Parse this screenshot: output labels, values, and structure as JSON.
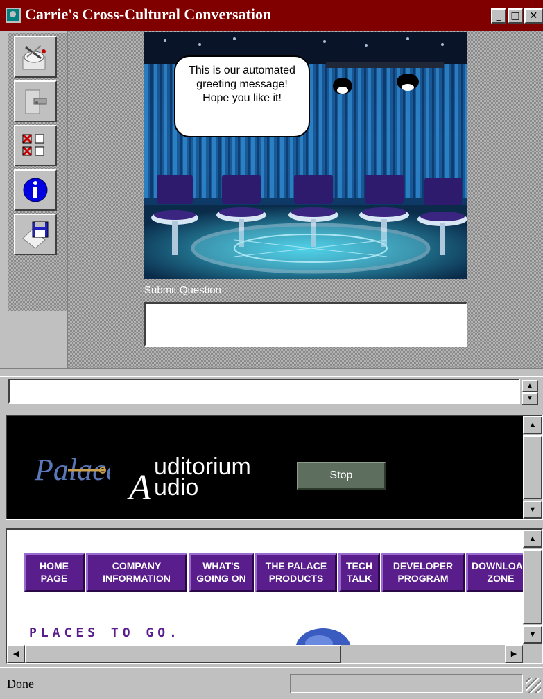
{
  "window": {
    "title": "Carrie's Cross-Cultural Conversation",
    "minimize_glyph": "_",
    "maximize_glyph": "□",
    "close_glyph": "✕"
  },
  "toolbar": {
    "buttons": [
      {
        "name": "prop-icon"
      },
      {
        "name": "door-icon"
      },
      {
        "name": "checklist-icon"
      },
      {
        "name": "info-icon"
      },
      {
        "name": "save-icon"
      }
    ]
  },
  "stage": {
    "greeting": "This is our automated greeting message! Hope you like it!",
    "submit_label": "Submit Question :",
    "submit_value": ""
  },
  "chat": {
    "input_value": "",
    "spin_up": "▲",
    "spin_down": "▼"
  },
  "audio": {
    "logo_text": "Palace",
    "title_initial": "A",
    "title_line1": "uditorium",
    "title_line2": "udio",
    "stop_label": "Stop"
  },
  "web": {
    "nav": [
      {
        "label": "HOME\nPAGE"
      },
      {
        "label": "COMPANY\nINFORMATION"
      },
      {
        "label": "WHAT'S\nGOING ON"
      },
      {
        "label": "THE PALACE\nPRODUCTS"
      },
      {
        "label": "TECH\nTALK"
      },
      {
        "label": "DEVELOPER\nPROGRAM"
      },
      {
        "label": "DOWNLOAD\nZONE"
      }
    ],
    "heading": "PLACES TO GO.",
    "scroll_left": "◀",
    "scroll_right": "▶",
    "scroll_up": "▲",
    "scroll_down": "▼"
  },
  "status": {
    "text": "Done"
  },
  "colors": {
    "titlebar": "#800000",
    "nav_purple": "#5a1e8c",
    "stop_button": "#5e6e5e"
  }
}
